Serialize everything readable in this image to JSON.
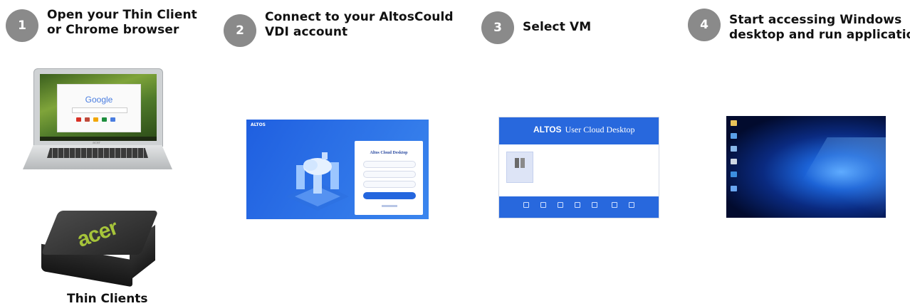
{
  "steps": [
    {
      "number": "1",
      "line1": "Open your Thin Client",
      "line2": "or Chrome browser"
    },
    {
      "number": "2",
      "line1": "Connect to your AltosCould",
      "line2": "VDI account"
    },
    {
      "number": "3",
      "line1": "Select VM",
      "line2": ""
    },
    {
      "number": "4",
      "line1": "Start accessing Windows",
      "line2": "desktop and run applications"
    }
  ],
  "laptop": {
    "screen_text": "Google",
    "brand": "acer"
  },
  "thin_client": {
    "brand": "acer",
    "caption": "Thin Clients"
  },
  "login_screen": {
    "brand": "ALTOS",
    "title": "Altos Cloud Desktop"
  },
  "vm_screen": {
    "brand": "ALTOS",
    "title": "User Cloud Desktop"
  },
  "colors": {
    "badge": "#8a8a8a",
    "accent_blue": "#2868dd",
    "acer_green": "#a6c43a"
  }
}
